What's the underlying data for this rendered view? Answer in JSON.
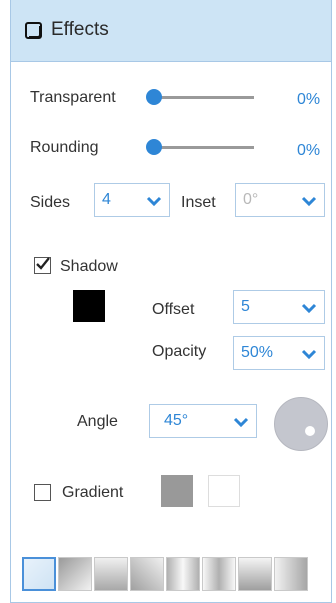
{
  "panel": {
    "title": "Effects",
    "icon": "panel-icon"
  },
  "transparent": {
    "label": "Transparent",
    "value_text": "0%",
    "value": 0
  },
  "rounding": {
    "label": "Rounding",
    "value_text": "0%",
    "value": 0
  },
  "sides": {
    "label": "Sides",
    "value": "4"
  },
  "inset": {
    "label": "Inset",
    "value": "0°"
  },
  "shadow": {
    "label": "Shadow",
    "checked": true,
    "color": "#000000",
    "offset_label": "Offset",
    "offset_value": "5",
    "opacity_label": "Opacity",
    "opacity_value": "50%"
  },
  "angle": {
    "label": "Angle",
    "value": "45°"
  },
  "gradient": {
    "label": "Gradient",
    "checked": false,
    "color1": "#999999",
    "color2": "#ffffff"
  },
  "gradient_presets": [
    "preset-1",
    "preset-2",
    "preset-3",
    "preset-4",
    "preset-5",
    "preset-6",
    "preset-7",
    "preset-8"
  ],
  "colors": {
    "accent": "#2e86d6",
    "header_bg": "#cde4f5",
    "border": "#a8c8e6"
  }
}
